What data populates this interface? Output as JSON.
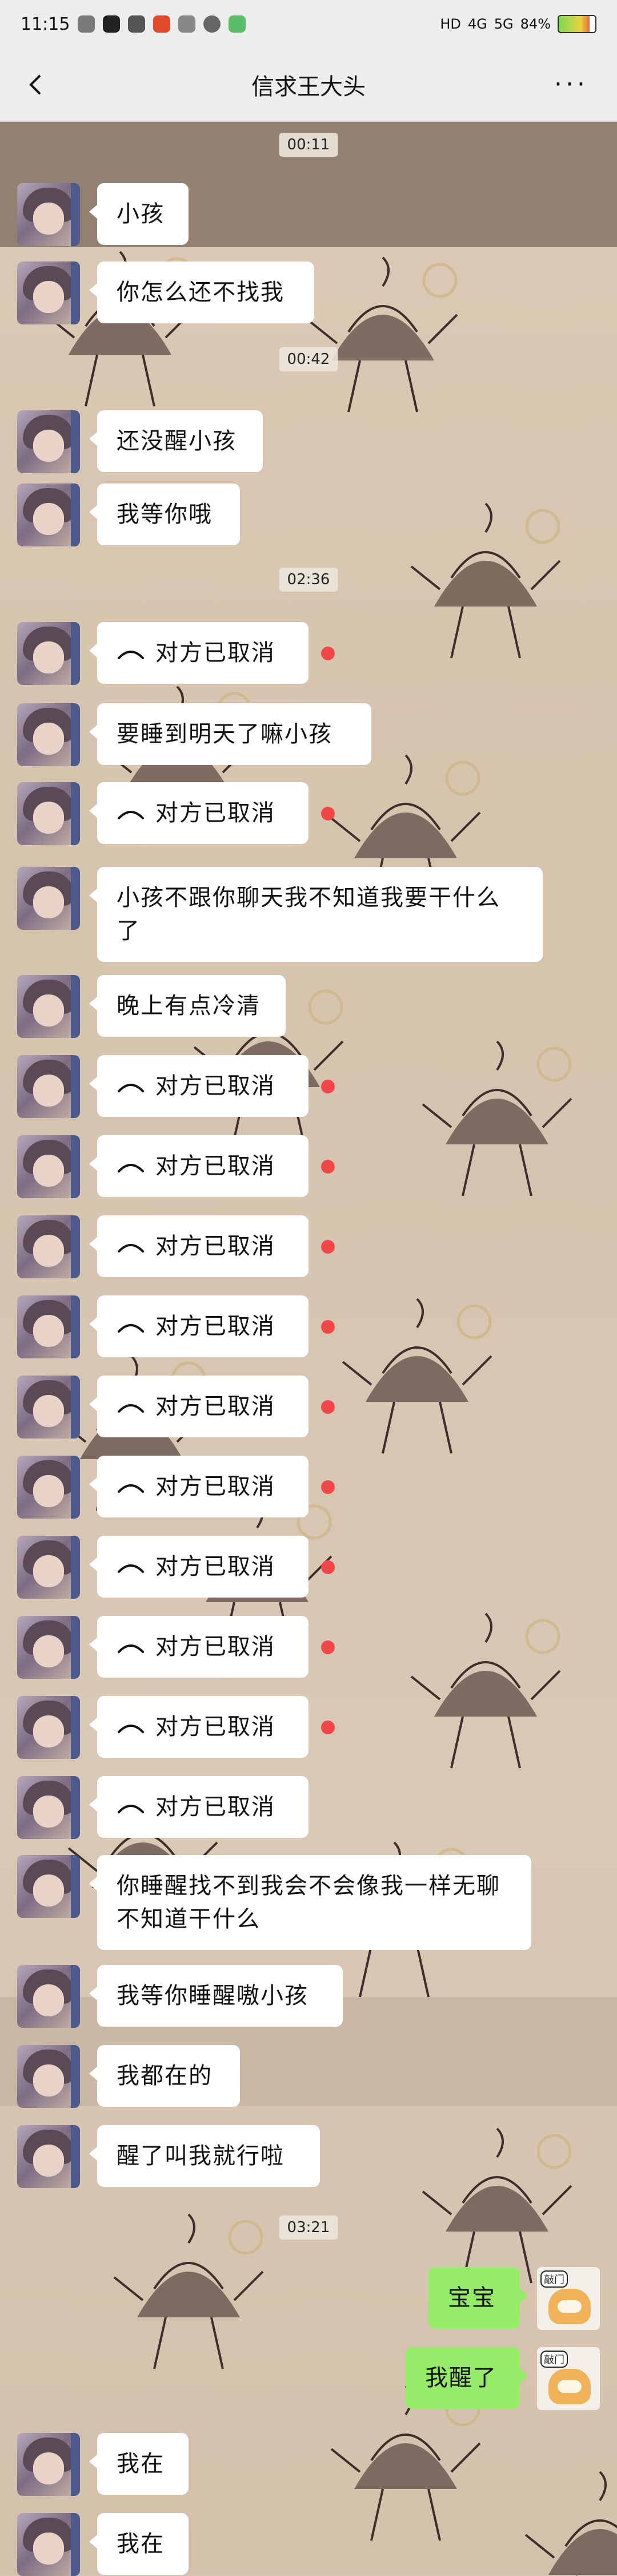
{
  "status_bar": {
    "time": "11:15",
    "network_badges": [
      "HD",
      "4G",
      "5G"
    ],
    "battery_percent": 84,
    "battery_label": "84%"
  },
  "header": {
    "title": "信求王大头",
    "back_icon": "chevron-left-icon",
    "more_icon": "more-dots-icon"
  },
  "messages": [
    {
      "kind": "time",
      "text": "00:11"
    },
    {
      "kind": "text",
      "from": "other",
      "text": "小孩"
    },
    {
      "kind": "text",
      "from": "other",
      "text": "你怎么还不找我"
    },
    {
      "kind": "time",
      "text": "00:42"
    },
    {
      "kind": "text",
      "from": "other",
      "text": "还没醒小孩"
    },
    {
      "kind": "text",
      "from": "other",
      "text": "我等你哦"
    },
    {
      "kind": "time",
      "text": "02:36"
    },
    {
      "kind": "call",
      "from": "other",
      "text": "对方已取消",
      "unread": true
    },
    {
      "kind": "text",
      "from": "other",
      "text": "要睡到明天了嘛小孩"
    },
    {
      "kind": "call",
      "from": "other",
      "text": "对方已取消",
      "unread": true
    },
    {
      "kind": "text",
      "from": "other",
      "text": "小孩不跟你聊天我不知道我要干什么了"
    },
    {
      "kind": "text",
      "from": "other",
      "text": "晚上有点冷清"
    },
    {
      "kind": "call",
      "from": "other",
      "text": "对方已取消",
      "unread": true
    },
    {
      "kind": "call",
      "from": "other",
      "text": "对方已取消",
      "unread": true
    },
    {
      "kind": "call",
      "from": "other",
      "text": "对方已取消",
      "unread": true
    },
    {
      "kind": "call",
      "from": "other",
      "text": "对方已取消",
      "unread": true
    },
    {
      "kind": "call",
      "from": "other",
      "text": "对方已取消",
      "unread": true
    },
    {
      "kind": "call",
      "from": "other",
      "text": "对方已取消",
      "unread": true
    },
    {
      "kind": "call",
      "from": "other",
      "text": "对方已取消",
      "unread": true
    },
    {
      "kind": "call",
      "from": "other",
      "text": "对方已取消",
      "unread": true
    },
    {
      "kind": "call",
      "from": "other",
      "text": "对方已取消",
      "unread": true
    },
    {
      "kind": "call",
      "from": "other",
      "text": "对方已取消",
      "unread": false
    },
    {
      "kind": "text",
      "from": "other",
      "text": "你睡醒找不到我会不会像我一样无聊不知道干什么"
    },
    {
      "kind": "text",
      "from": "other",
      "text": "我等你睡醒嗷小孩"
    },
    {
      "kind": "text",
      "from": "other",
      "text": "我都在的"
    },
    {
      "kind": "text",
      "from": "other",
      "text": "醒了叫我就行啦"
    },
    {
      "kind": "time",
      "text": "03:21"
    },
    {
      "kind": "text",
      "from": "me",
      "text": "宝宝"
    },
    {
      "kind": "text",
      "from": "me",
      "text": "我醒了"
    },
    {
      "kind": "text",
      "from": "other",
      "text": "我在"
    },
    {
      "kind": "text",
      "from": "other",
      "text": "我在"
    }
  ],
  "sticker_label": "敲门",
  "colors": {
    "self_bubble": "#95ec69",
    "other_bubble": "#ffffff",
    "unread_dot": "#f04848",
    "bar_bg": "#ededed"
  }
}
